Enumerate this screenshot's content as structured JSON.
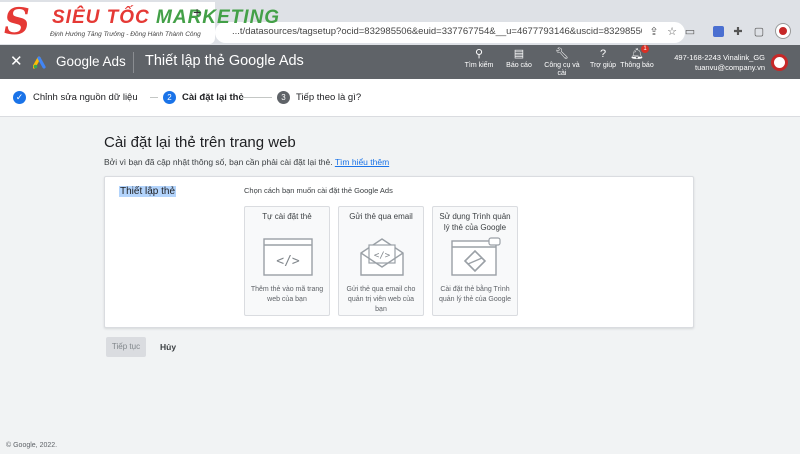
{
  "watermark": {
    "brand_part1": "SIÊU TỐC ",
    "brand_part2": "MARKETING",
    "tagline": "Định Hướng Tăng Trưởng - Đồng Hành Thành Công"
  },
  "browser": {
    "new_tab_icon": "plus-icon",
    "url": "...t/datasources/tagsetup?ocid=832985506&euid=337767754&__u=4677793146&uscid=832985506&__c=3156024..."
  },
  "header": {
    "product": "Google Ads",
    "page_title": "Thiết lập thẻ Google Ads",
    "tools": [
      {
        "icon": "search-icon",
        "label": "Tìm kiếm"
      },
      {
        "icon": "reports-icon",
        "label": "Báo cáo"
      },
      {
        "icon": "wrench-icon",
        "label": "Công cụ và cài"
      },
      {
        "icon": "help-icon",
        "label": "Trợ giúp"
      },
      {
        "icon": "bell-icon",
        "label": "Thông báo"
      }
    ],
    "notification_count": "1",
    "account_id": "497-168-2243 Vinalink_GG",
    "account_email": "tuanvu@company.vn"
  },
  "stepper": {
    "steps": [
      {
        "num": "✓",
        "label": "Chỉnh sửa nguồn dữ liệu",
        "state": "done"
      },
      {
        "num": "2",
        "label": "Cài đặt lại thẻ",
        "state": "active"
      },
      {
        "num": "3",
        "label": "Tiếp theo là gì?",
        "state": "pending"
      }
    ]
  },
  "main": {
    "heading": "Cài đặt lại thẻ trên trang web",
    "subtitle": "Bởi vì bạn đã cập nhật thông số, bạn cần phải cài đặt lại thẻ.",
    "learn_more": "Tìm hiểu thêm",
    "section_label": "Thiết lập thẻ",
    "choose_label": "Chọn cách bạn muốn cài đặt thẻ Google Ads",
    "options": [
      {
        "title": "Tự cài đặt thẻ",
        "description": "Thêm thẻ vào mã trang web của bạn",
        "icon": "code-window-icon"
      },
      {
        "title": "Gửi thẻ qua email",
        "description": "Gửi thẻ qua email cho quản trị viên web của bạn",
        "icon": "email-code-icon"
      },
      {
        "title": "Sử dụng Trình quản lý thẻ của Google",
        "description": "Cài đặt thẻ bằng Trình quản lý thẻ của Google",
        "icon": "tag-manager-icon"
      }
    ],
    "continue_label": "Tiếp tục",
    "cancel_label": "Hủy"
  },
  "footer": "© Google, 2022.",
  "colors": {
    "accent": "#1a73e8",
    "header_bg": "#5f6368",
    "brand_red": "#e53935",
    "brand_green": "#43a047"
  }
}
